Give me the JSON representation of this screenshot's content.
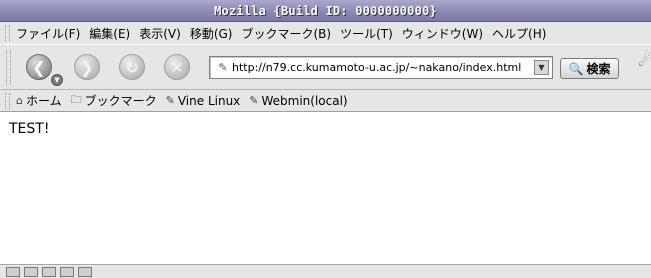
{
  "window": {
    "title": "Mozilla {Build ID: 0000000000}"
  },
  "menubar": {
    "items": [
      {
        "label": "ファイル(F)"
      },
      {
        "label": "編集(E)"
      },
      {
        "label": "表示(V)"
      },
      {
        "label": "移動(G)"
      },
      {
        "label": "ブックマーク(B)"
      },
      {
        "label": "ツール(T)"
      },
      {
        "label": "ウィンドウ(W)"
      },
      {
        "label": "ヘルプ(H)"
      }
    ]
  },
  "navigation": {
    "back_icon": "back-arrow-icon",
    "forward_icon": "forward-arrow-icon",
    "reload_icon": "reload-icon",
    "stop_icon": "stop-icon",
    "url": "http://n79.cc.kumamoto-u.ac.jp/~nakano/index.html",
    "search_label": "検索"
  },
  "personal_toolbar": {
    "items": [
      {
        "label": "ホーム",
        "icon": "home-icon"
      },
      {
        "label": "ブックマーク",
        "icon": "folder-icon"
      },
      {
        "label": "Vine Linux",
        "icon": "bookmark-icon"
      },
      {
        "label": "Webmin(local)",
        "icon": "bookmark-icon"
      }
    ]
  },
  "content": {
    "text": "TEST!"
  }
}
